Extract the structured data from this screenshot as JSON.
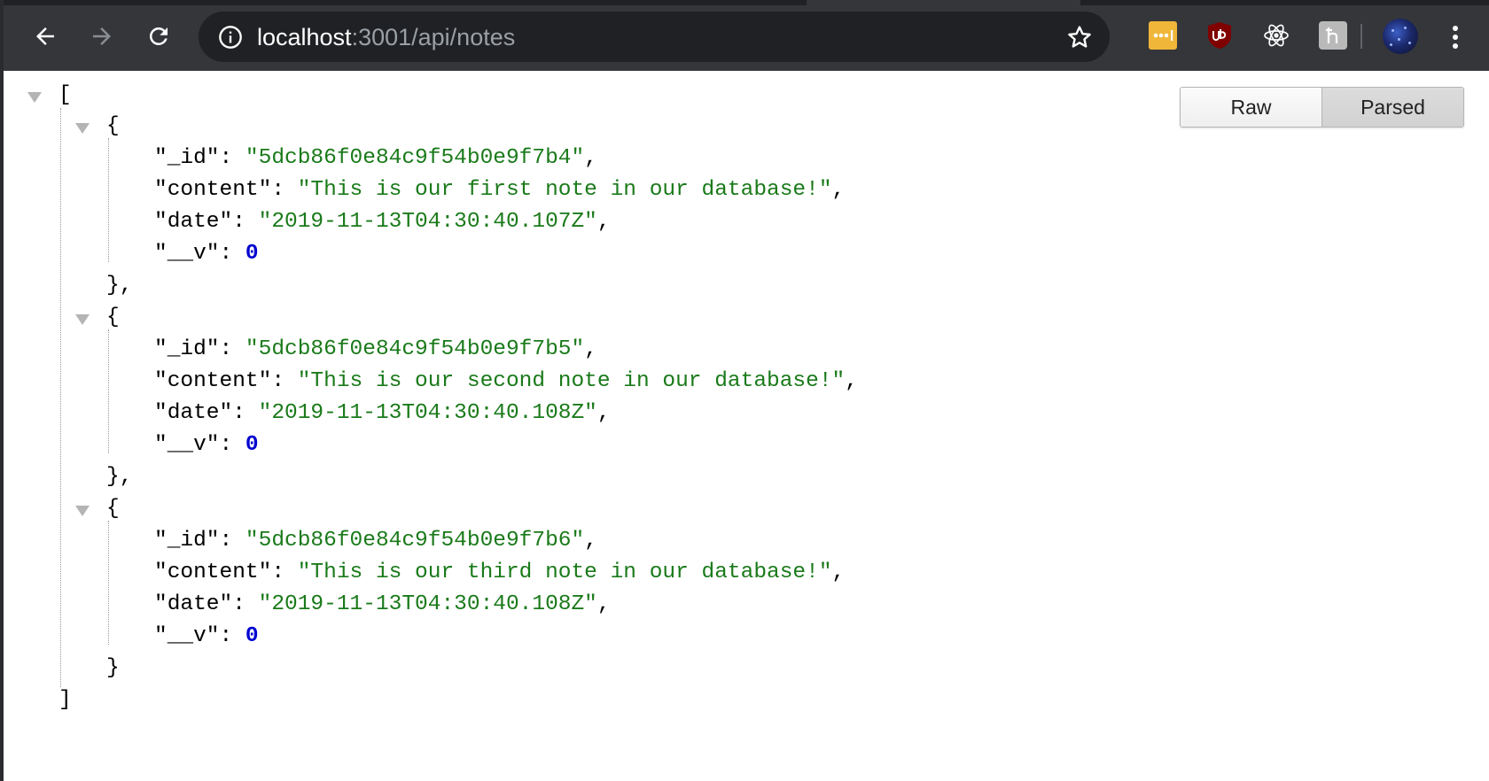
{
  "browser": {
    "url_host": "localhost",
    "url_rest": ":3001/api/notes",
    "icons": {
      "back": "arrow-left-icon",
      "forward": "arrow-right-icon",
      "reload": "reload-icon",
      "info": "info-icon",
      "bookmark": "star-icon",
      "lastpass": "lastpass-extension-icon",
      "ublock": "ublock-origin-extension-icon",
      "react": "react-devtools-extension-icon",
      "hypothesis": "hypothesis-extension-icon",
      "menu": "kebab-menu-icon"
    },
    "colors": {
      "toolbar": "#35363a",
      "omnibox": "#202124",
      "lastpass": "#f0b63a",
      "ublock": "#800000"
    }
  },
  "viewer": {
    "raw_label": "Raw",
    "parsed_label": "Parsed",
    "selected": "Parsed"
  },
  "json": {
    "open_bracket": "[",
    "close_bracket": "]",
    "notes": [
      {
        "_id": "\"5dcb86f0e84c9f54b0e9f7b4\"",
        "content": "\"This is our first note in our database!\"",
        "date": "\"2019-11-13T04:30:40.107Z\"",
        "__v": "0"
      },
      {
        "_id": "\"5dcb86f0e84c9f54b0e9f7b5\"",
        "content": "\"This is our second note in our database!\"",
        "date": "\"2019-11-13T04:30:40.108Z\"",
        "__v": "0"
      },
      {
        "_id": "\"5dcb86f0e84c9f54b0e9f7b6\"",
        "content": "\"This is our third note in our database!\"",
        "date": "\"2019-11-13T04:30:40.108Z\"",
        "__v": "0"
      }
    ],
    "keys": {
      "id": "\"_id\"",
      "content": "\"content\"",
      "date": "\"date\"",
      "v": "\"__v\""
    }
  }
}
